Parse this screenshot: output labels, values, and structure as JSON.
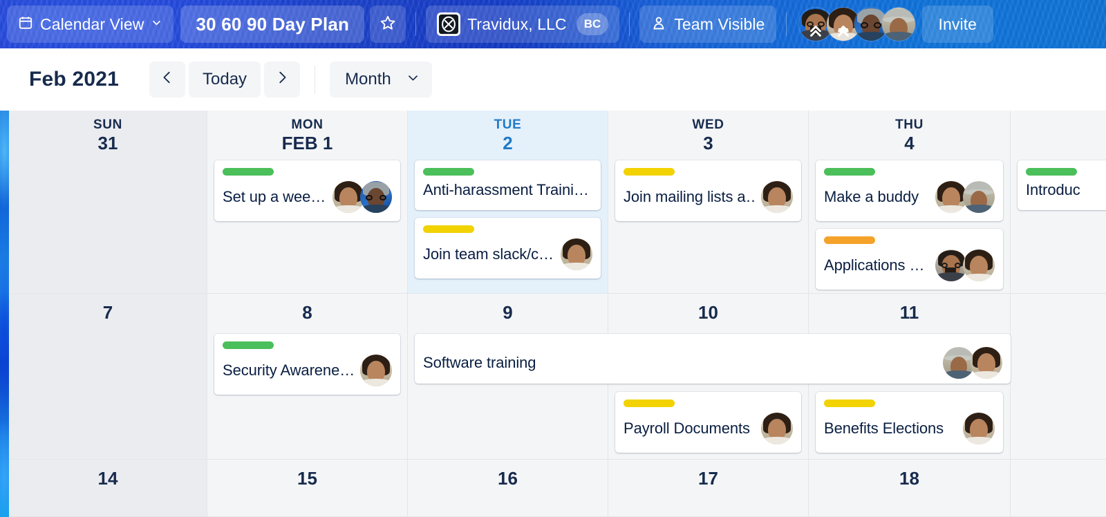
{
  "header": {
    "view_switcher": {
      "label": "Calendar View",
      "icon": "calendar-icon",
      "chevron": "chevron-down-icon"
    },
    "board_title": "30 60 90 Day Plan",
    "star_icon": "star-icon",
    "workspace": {
      "name": "Travidux, LLC",
      "initials": "BC",
      "logo_icon": "xy-logo-icon"
    },
    "visibility": {
      "label": "Team Visible",
      "icon": "people-icon"
    },
    "invite_label": "Invite",
    "members": [
      {
        "name": "member-1",
        "badge": "chevrons-up-icon"
      },
      {
        "name": "member-2",
        "badge": "chevrons-up-icon"
      },
      {
        "name": "member-3",
        "badge": ""
      },
      {
        "name": "member-4",
        "badge": ""
      }
    ]
  },
  "toolbar": {
    "period_label": "Feb 2021",
    "prev_label": "‹",
    "today_label": "Today",
    "next_label": "›",
    "view_select": {
      "value": "Month",
      "chevron": "chevron-down-icon"
    }
  },
  "colors": {
    "label_green": "#4bbf5a",
    "label_yellow": "#f2d200",
    "label_orange": "#f5a22a",
    "today_blue": "#1e7ac8",
    "text_dark": "#172b4d"
  },
  "calendar": {
    "weeks": [
      {
        "days": [
          {
            "dow": "SUN",
            "num": "31",
            "weekend": true,
            "today": false,
            "show_dow": true
          },
          {
            "dow": "MON",
            "num": "FEB 1",
            "weekend": false,
            "today": false,
            "show_dow": true
          },
          {
            "dow": "TUE",
            "num": "2",
            "weekend": false,
            "today": true,
            "show_dow": true
          },
          {
            "dow": "WED",
            "num": "3",
            "weekend": false,
            "today": false,
            "show_dow": true
          },
          {
            "dow": "THU",
            "num": "4",
            "weekend": false,
            "today": false,
            "show_dow": true
          },
          {
            "dow": "",
            "num": "",
            "weekend": false,
            "today": false,
            "show_dow": true
          }
        ]
      },
      {
        "days": [
          {
            "dow": "",
            "num": "7",
            "weekend": true,
            "today": false,
            "show_dow": false
          },
          {
            "dow": "",
            "num": "8",
            "weekend": false,
            "today": false,
            "show_dow": false
          },
          {
            "dow": "",
            "num": "9",
            "weekend": false,
            "today": false,
            "show_dow": false
          },
          {
            "dow": "",
            "num": "10",
            "weekend": false,
            "today": false,
            "show_dow": false
          },
          {
            "dow": "",
            "num": "11",
            "weekend": false,
            "today": false,
            "show_dow": false
          },
          {
            "dow": "",
            "num": "",
            "weekend": false,
            "today": false,
            "show_dow": false
          }
        ]
      },
      {
        "days": [
          {
            "dow": "",
            "num": "14",
            "weekend": true,
            "today": false,
            "show_dow": false
          },
          {
            "dow": "",
            "num": "15",
            "weekend": false,
            "today": false,
            "show_dow": false
          },
          {
            "dow": "",
            "num": "16",
            "weekend": false,
            "today": false,
            "show_dow": false
          },
          {
            "dow": "",
            "num": "17",
            "weekend": false,
            "today": false,
            "show_dow": false
          },
          {
            "dow": "",
            "num": "18",
            "weekend": false,
            "today": false,
            "show_dow": false
          },
          {
            "dow": "",
            "num": "",
            "weekend": false,
            "today": false,
            "show_dow": false
          }
        ]
      }
    ],
    "events": {
      "w1d2_1": {
        "title": "Set up a wee…",
        "label_color": "green",
        "members": 2
      },
      "w1d3_1": {
        "title": "Anti-harassment Traini…",
        "label_color": "green",
        "members": 0
      },
      "w1d3_2": {
        "title": "Join team slack/c…",
        "label_color": "yellow",
        "members": 1
      },
      "w1d4_1": {
        "title": "Join mailing lists a…",
        "label_color": "yellow",
        "members": 1
      },
      "w1d5_1": {
        "title": "Make a buddy",
        "label_color": "green",
        "members": 2
      },
      "w1d5_2": {
        "title": "Applications …",
        "label_color": "orange",
        "members": 2
      },
      "w1d6_1": {
        "title": "Introduc",
        "label_color": "green",
        "members": 0
      },
      "w2d2_1": {
        "title": "Security Awarene…",
        "label_color": "green",
        "members": 1
      },
      "w2_span": {
        "title": "Software training",
        "label_color": "orange",
        "members": 2
      },
      "w2d4_1": {
        "title": "Payroll Documents",
        "label_color": "yellow",
        "members": 1
      },
      "w2d5_1": {
        "title": "Benefits Elections",
        "label_color": "yellow",
        "members": 1
      }
    }
  }
}
